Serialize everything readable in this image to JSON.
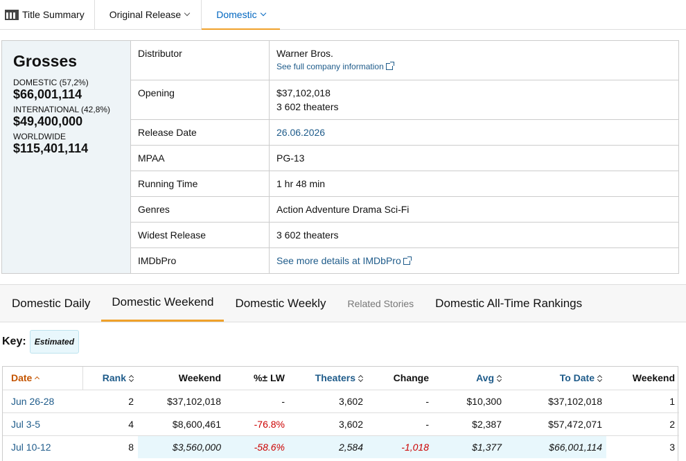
{
  "topnav": {
    "title_summary": "Title Summary",
    "original_release": "Original Release",
    "domestic": "Domestic"
  },
  "grosses": {
    "heading": "Grosses",
    "domestic_label": "DOMESTIC (57,2%)",
    "domestic_value": "$66,001,114",
    "international_label": "INTERNATIONAL (42,8%)",
    "international_value": "$49,400,000",
    "worldwide_label": "WORLDWIDE",
    "worldwide_value": "$115,401,114"
  },
  "details": {
    "distributor_key": "Distributor",
    "distributor_value": "Warner Bros.",
    "distributor_link": "See full company information",
    "opening_key": "Opening",
    "opening_value": "$37,102,018",
    "opening_theaters": "3 602 theaters",
    "release_key": "Release Date",
    "release_value": "26.06.2026",
    "mpaa_key": "MPAA",
    "mpaa_value": "PG-13",
    "runtime_key": "Running Time",
    "runtime_value": "1 hr 48 min",
    "genres_key": "Genres",
    "genres_value": "Action Adventure Drama Sci-Fi",
    "widest_key": "Widest Release",
    "widest_value": "3 602 theaters",
    "imdbpro_key": "IMDbPro",
    "imdbpro_link": "See more details at IMDbPro"
  },
  "subnav": {
    "daily": "Domestic Daily",
    "weekend": "Domestic Weekend",
    "weekly": "Domestic Weekly",
    "stories": "Related Stories",
    "alltime": "Domestic All-Time Rankings"
  },
  "key": {
    "label": "Key:",
    "estimated": "Estimated"
  },
  "table": {
    "headers": {
      "date": "Date",
      "rank": "Rank",
      "weekend": "Weekend",
      "lw": "%± LW",
      "theaters": "Theaters",
      "change": "Change",
      "avg": "Avg",
      "todate": "To Date",
      "weekno": "Weekend"
    },
    "rows": [
      {
        "date": "Jun 26-28",
        "rank": "2",
        "weekend": "$37,102,018",
        "lw": "-",
        "theaters": "3,602",
        "change": "-",
        "avg": "$10,300",
        "todate": "$37,102,018",
        "weekno": "1"
      },
      {
        "date": "Jul 3-5",
        "rank": "4",
        "weekend": "$8,600,461",
        "lw": "-76.8%",
        "theaters": "3,602",
        "change": "-",
        "avg": "$2,387",
        "todate": "$57,472,071",
        "weekno": "2"
      },
      {
        "date": "Jul 10-12",
        "rank": "8",
        "weekend": "$3,560,000",
        "lw": "-58.6%",
        "theaters": "2,584",
        "change": "-1,018",
        "avg": "$1,377",
        "todate": "$66,001,114",
        "weekno": "3"
      }
    ]
  }
}
